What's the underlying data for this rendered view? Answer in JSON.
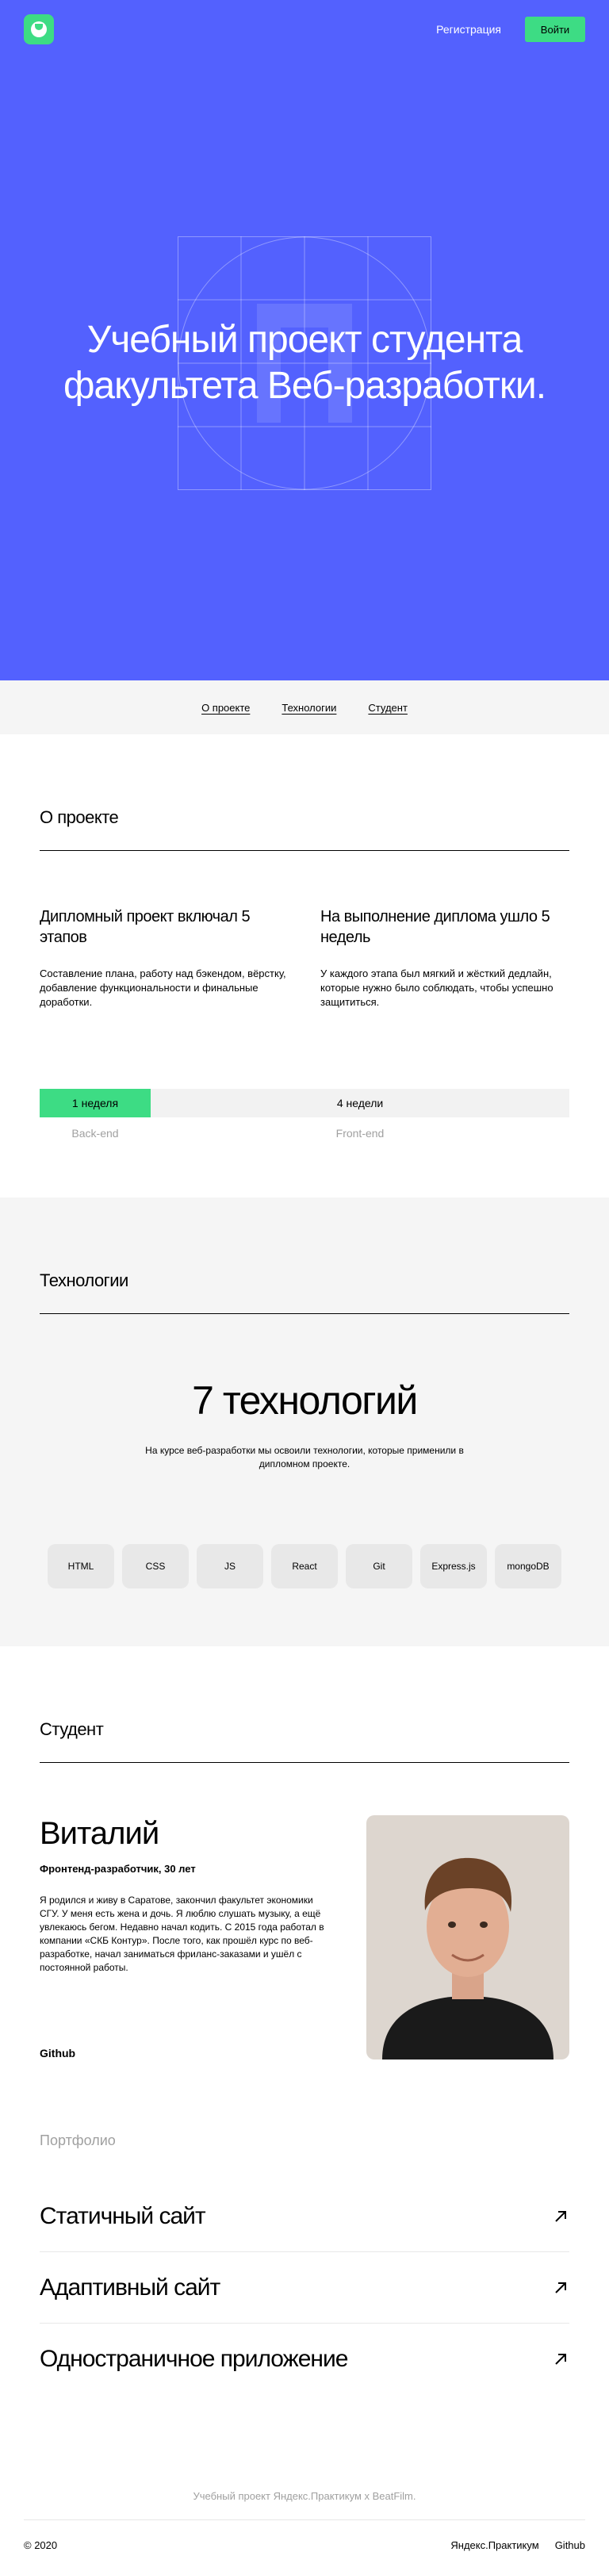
{
  "header": {
    "logo_icon": "smile-logo-icon",
    "register_label": "Регистрация",
    "login_label": "Войти"
  },
  "hero": {
    "title_line1": "Учебный проект студента",
    "title_line2": "факультета Веб-разработки."
  },
  "nav": {
    "links": [
      "О проекте",
      "Технологии",
      "Студент"
    ]
  },
  "about": {
    "title": "О проекте",
    "cols": [
      {
        "heading": "Дипломный проект включал 5 этапов",
        "text": "Составление плана, работу над бэкендом, вёрстку, добавление функциональности и финальные доработки."
      },
      {
        "heading": "На выполнение диплома ушло 5 недель",
        "text": "У каждого этапа был мягкий и жёсткий дедлайн, которые нужно было соблюдать, чтобы успешно защититься."
      }
    ],
    "timeline": {
      "backend_duration": "1 неделя",
      "frontend_duration": "4 недели",
      "backend_label": "Back-end",
      "frontend_label": "Front-end"
    }
  },
  "tech": {
    "title": "Технологии",
    "headline": "7 технологий",
    "description": "На курсе веб-разработки мы освоили технологии, которые применили в дипломном проекте.",
    "items": [
      "HTML",
      "CSS",
      "JS",
      "React",
      "Git",
      "Express.js",
      "mongoDB"
    ]
  },
  "student": {
    "title": "Студент",
    "name": "Виталий",
    "job": "Фронтенд-разработчик, 30 лет",
    "bio": "Я родился и живу в Саратове, закончил факультет экономики СГУ. У меня есть жена и дочь. Я люблю слушать музыку, а ещё увлекаюсь бегом. Недавно начал кодить. С 2015 года работал в компании «СКБ Контур». После того, как прошёл курс по веб-разработке, начал заниматься фриланс-заказами и ушёл с постоянной работы.",
    "github": "Github"
  },
  "portfolio": {
    "title": "Портфолио",
    "items": [
      "Статичный сайт",
      "Адаптивный сайт",
      "Одностраничное приложение"
    ],
    "arrow_icon": "arrow-up-right-icon"
  },
  "footer": {
    "note": "Учебный проект Яндекс.Практикум х BeatFilm.",
    "copyright": "© 2020",
    "links": [
      "Яндекс.Практикум",
      "Github"
    ]
  },
  "colors": {
    "hero_bg": "#5361fe",
    "accent_green": "#3ddc84",
    "light_bg": "#f5f5f5"
  }
}
